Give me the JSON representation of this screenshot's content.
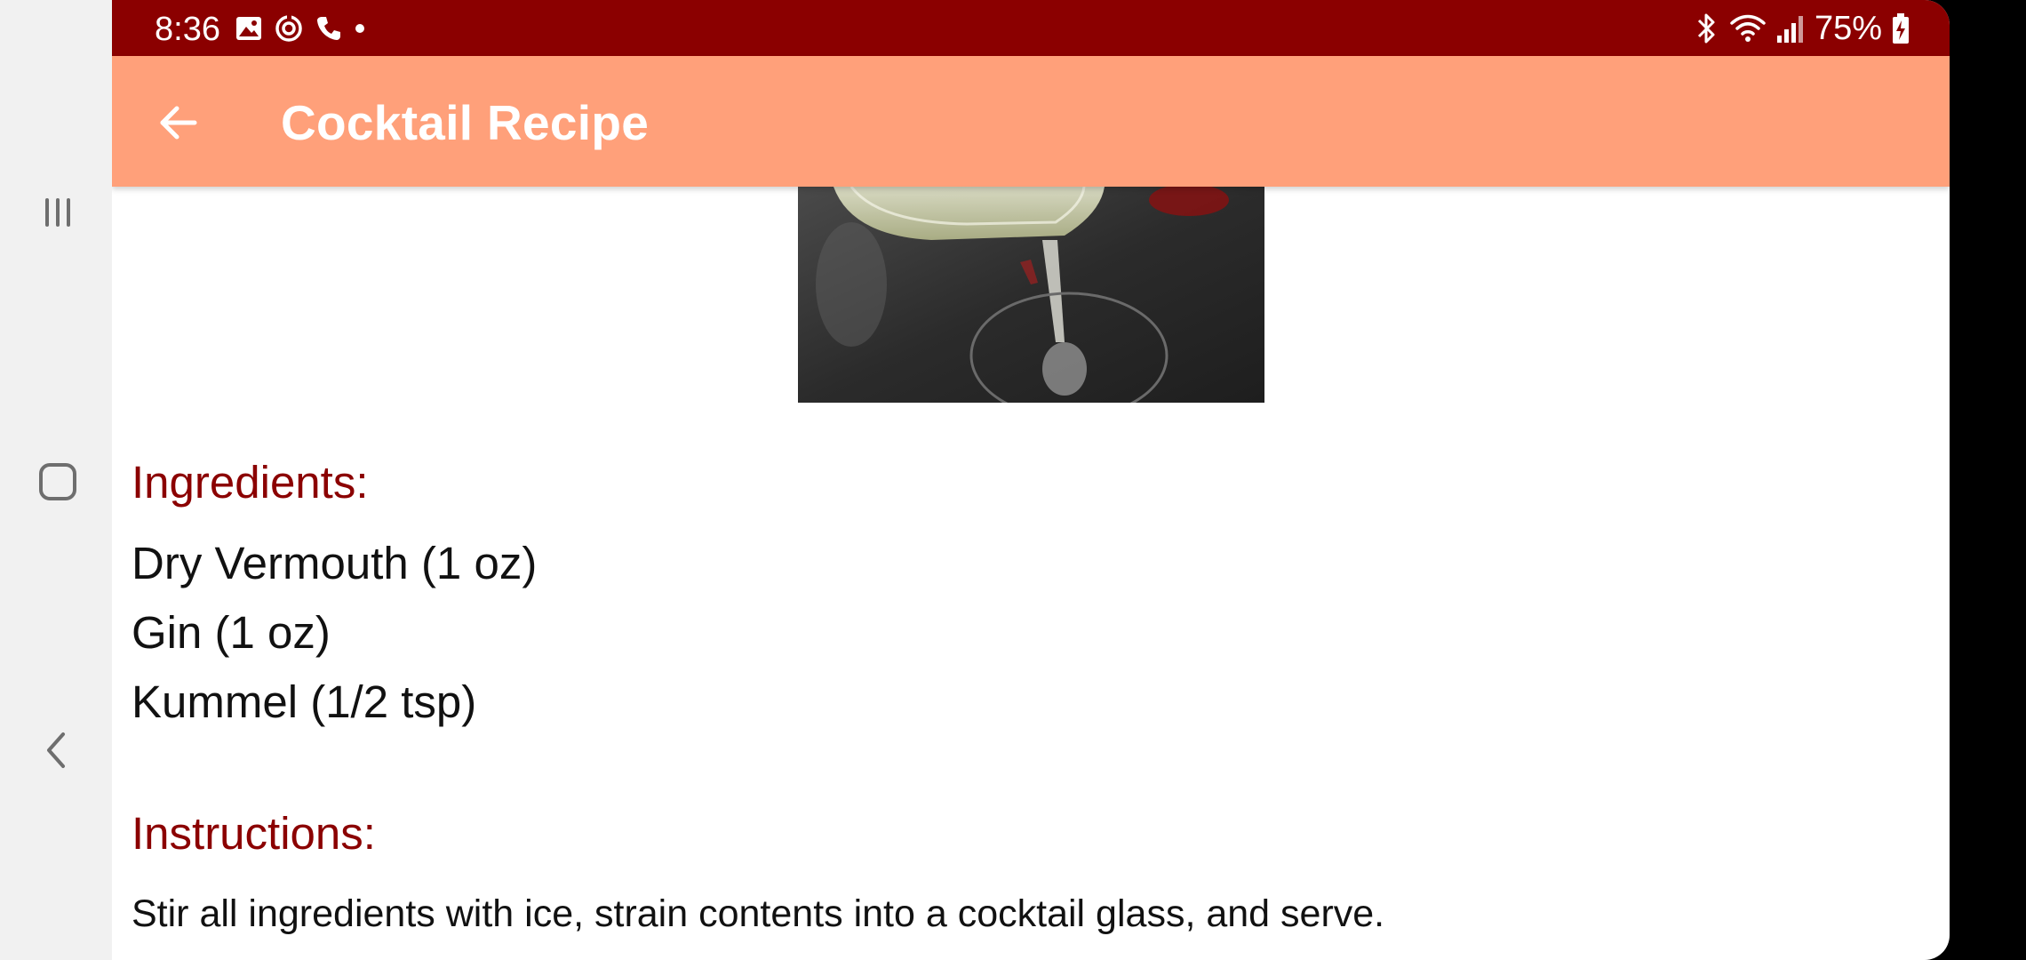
{
  "status_bar": {
    "time": "8:36",
    "battery": "75%",
    "left_icons": [
      "gallery-icon",
      "sync-icon",
      "phone-call-icon",
      "dot-icon"
    ],
    "right_icons": [
      "bluetooth-icon",
      "wifi-icon",
      "signal-icon",
      "battery-icon"
    ]
  },
  "nav_bar": {
    "buttons": [
      "recent-apps-icon",
      "home-icon",
      "back-nav-icon"
    ]
  },
  "app_bar": {
    "title": "Cocktail Recipe",
    "back_icon": "arrow-back-icon"
  },
  "recipe": {
    "ingredients_heading": "Ingredients:",
    "ingredients": [
      "Dry Vermouth (1 oz)",
      "Gin (1 oz)",
      "Kummel (1/2 tsp)"
    ],
    "instructions_heading": "Instructions:",
    "instructions": "Stir all ingredients with ice, strain contents into a cocktail glass, and serve."
  },
  "colors": {
    "status_bar": "#8b0000",
    "app_bar": "#ffa07a",
    "heading": "#8b0000",
    "nav_rail": "#f1f1f1"
  }
}
